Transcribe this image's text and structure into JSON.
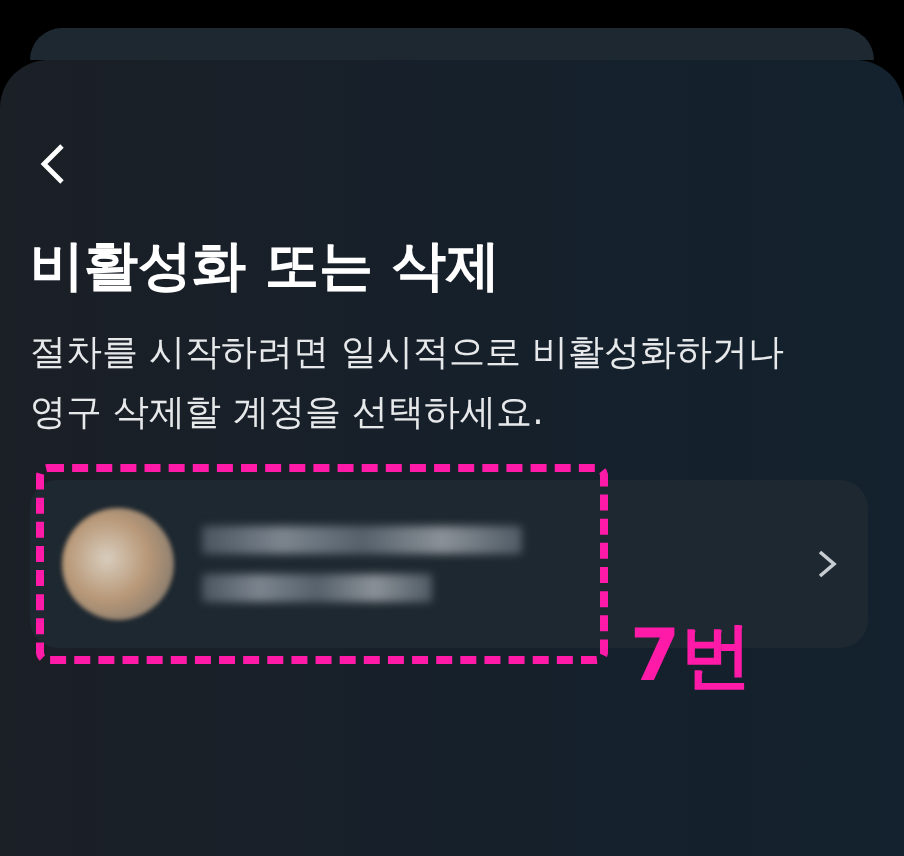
{
  "screen": {
    "title": "비활성화 또는 삭제",
    "description": "절차를 시작하려면 일시적으로 비활성화하거나 영구 삭제할 계정을 선택하세요."
  },
  "accounts": [
    {
      "kind": "redacted",
      "highlighted": true
    }
  ],
  "annotation": {
    "label": "7번"
  }
}
